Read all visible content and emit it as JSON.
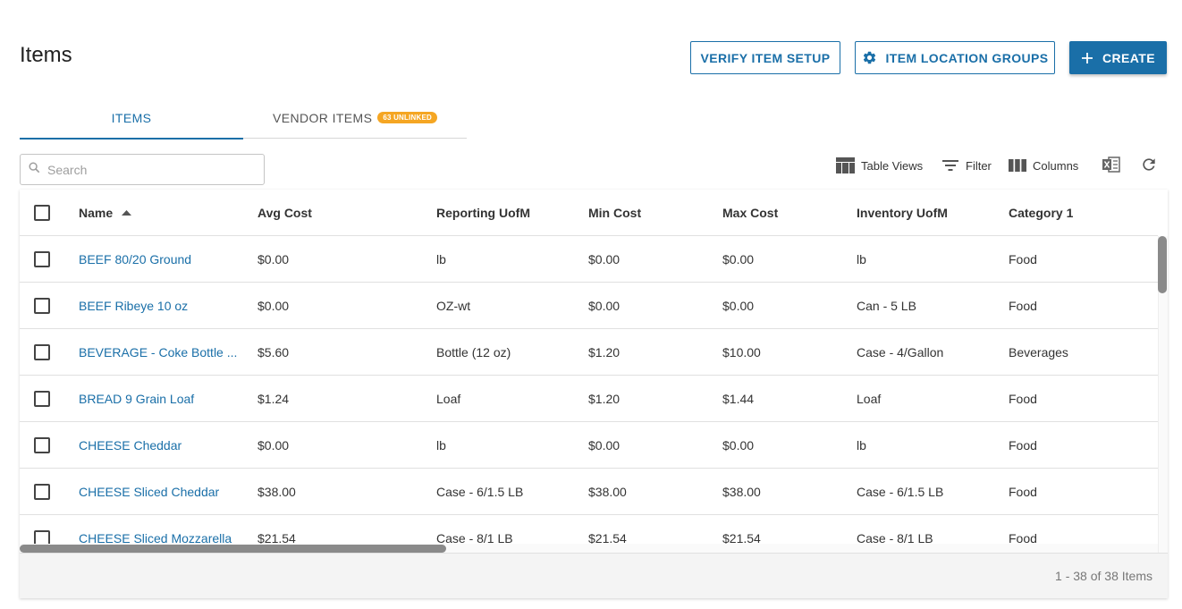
{
  "page": {
    "title": "Items"
  },
  "header_buttons": {
    "verify": "VERIFY ITEM SETUP",
    "location_groups": "ITEM LOCATION GROUPS",
    "create": "CREATE"
  },
  "tabs": [
    {
      "label": "ITEMS",
      "active": true
    },
    {
      "label": "VENDOR ITEMS",
      "badge": "63 UNLINKED",
      "active": false
    }
  ],
  "search": {
    "placeholder": "Search",
    "value": ""
  },
  "toolbar": {
    "table_views": "Table Views",
    "filter": "Filter",
    "columns": "Columns",
    "export_icon": "excel-export-icon",
    "refresh_icon": "refresh-icon"
  },
  "columns": [
    "Name",
    "Avg Cost",
    "Reporting UofM",
    "Min Cost",
    "Max Cost",
    "Inventory UofM",
    "Category 1"
  ],
  "sort": {
    "column": "Name",
    "direction": "ascending"
  },
  "rows": [
    [
      "BEEF 80/20 Ground",
      "$0.00",
      "lb",
      "$0.00",
      "$0.00",
      "lb",
      "Food"
    ],
    [
      "BEEF Ribeye 10 oz",
      "$0.00",
      "OZ-wt",
      "$0.00",
      "$0.00",
      "Can - 5 LB",
      "Food"
    ],
    [
      "BEVERAGE - Coke Bottle ...",
      "$5.60",
      "Bottle (12 oz)",
      "$1.20",
      "$10.00",
      "Case - 4/Gallon",
      "Beverages"
    ],
    [
      "BREAD 9 Grain Loaf",
      "$1.24",
      "Loaf",
      "$1.20",
      "$1.44",
      "Loaf",
      "Food"
    ],
    [
      "CHEESE Cheddar",
      "$0.00",
      "lb",
      "$0.00",
      "$0.00",
      "lb",
      "Food"
    ],
    [
      "CHEESE Sliced Cheddar",
      "$38.00",
      "Case - 6/1.5 LB",
      "$38.00",
      "$38.00",
      "Case - 6/1.5 LB",
      "Food"
    ],
    [
      "CHEESE Sliced Mozzarella",
      "$21.54",
      "Case - 8/1 LB",
      "$21.54",
      "$21.54",
      "Case - 8/1 LB",
      "Food"
    ]
  ],
  "footer": {
    "pagination": "1 - 38 of 38 Items"
  },
  "colors": {
    "accent": "#1a6fa8",
    "badge": "#f5a623"
  }
}
